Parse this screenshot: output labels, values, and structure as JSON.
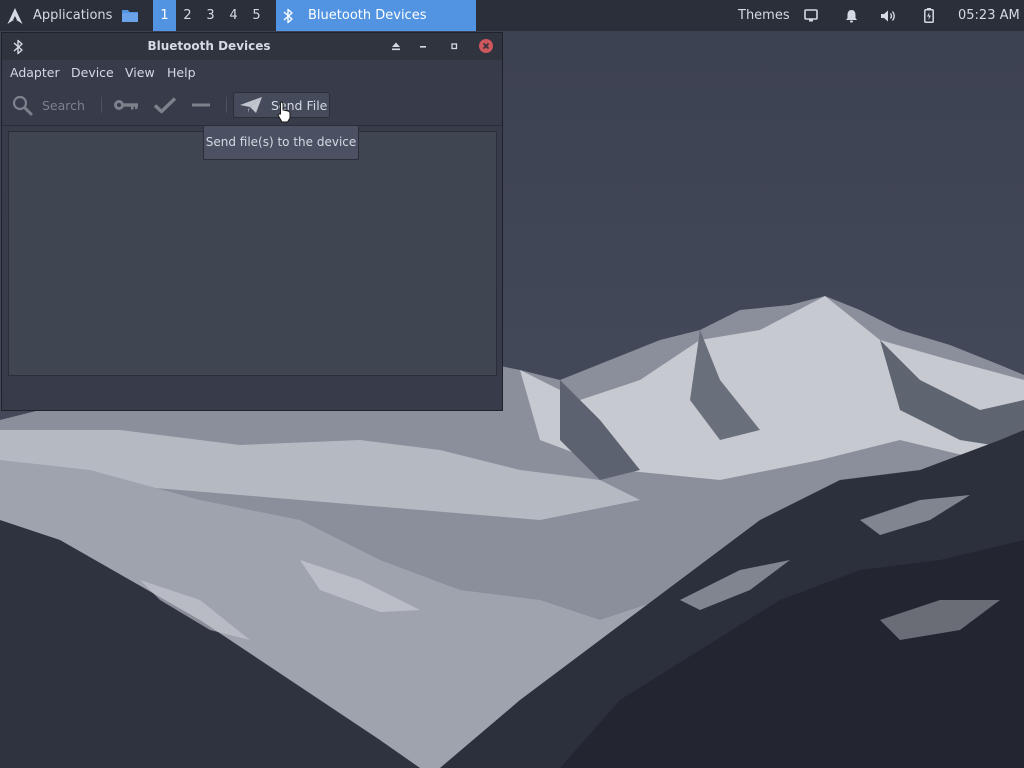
{
  "panel": {
    "applications_label": "Applications",
    "workspaces": [
      "1",
      "2",
      "3",
      "4",
      "5"
    ],
    "active_workspace": "1",
    "taskbar_entry": "Bluetooth Devices",
    "themes_label": "Themes",
    "clock": "05:23 AM",
    "icons": {
      "apps": "arch-logo-icon",
      "files": "folder-icon",
      "taskbar": "bluetooth-icon",
      "tray": [
        "display-icon",
        "bell-icon",
        "volume-icon",
        "battery-icon"
      ]
    }
  },
  "window": {
    "title": "Bluetooth Devices",
    "title_icon": "bluetooth-icon",
    "controls": [
      "shade-icon",
      "minimize-icon",
      "maximize-icon",
      "close-icon"
    ],
    "menu": {
      "adapter": "Adapter",
      "device": "Device",
      "view": "View",
      "help": "Help"
    },
    "toolbar": {
      "search_label": "Search",
      "send_file_label": "Send File",
      "icons": [
        "search-icon",
        "key-icon",
        "check-icon",
        "minus-icon",
        "paper-plane-icon"
      ]
    }
  },
  "tooltip": {
    "text": "Send file(s) to the device"
  },
  "colors": {
    "panel_bg": "#2b2f3a",
    "accent": "#5294e2",
    "window_bg": "#383c4a",
    "close_button": "#cc575d"
  }
}
